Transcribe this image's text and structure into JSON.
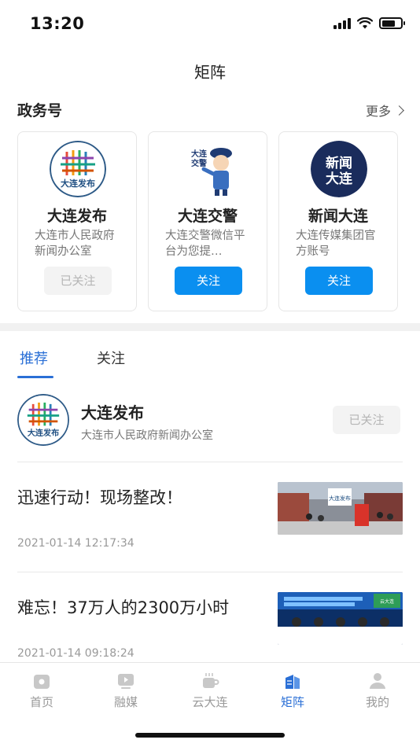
{
  "status_bar": {
    "time": "13:20"
  },
  "nav": {
    "title": "矩阵"
  },
  "gov_section": {
    "title": "政务号",
    "more_label": "更多"
  },
  "cards": [
    {
      "name": "大连发布",
      "desc": "大连市人民政府新闻办公室",
      "button": "已关注",
      "followed": true,
      "logo_text": "大连发布"
    },
    {
      "name": "大连交警",
      "desc": "大连交警微信平台为您提…",
      "button": "关注",
      "followed": false,
      "logo_text": "大连交警"
    },
    {
      "name": "新闻大连",
      "desc": "大连传媒集团官方账号",
      "button": "关注",
      "followed": false,
      "logo_text": "新闻大连"
    }
  ],
  "tabs": [
    {
      "label": "推荐",
      "active": true
    },
    {
      "label": "关注",
      "active": false
    }
  ],
  "account": {
    "name": "大连发布",
    "desc": "大连市人民政府新闻办公室",
    "button": "已关注",
    "logo_text": "大连发布"
  },
  "news": [
    {
      "title": "迅速行动！现场整改！",
      "date": "2021-01-14 12:17:34",
      "thumb_sign": "大连发布"
    },
    {
      "title": "难忘！37万人的2300万小时",
      "date": "2021-01-14 09:18:24",
      "thumb_sign": "云大连"
    }
  ],
  "tabbar": [
    {
      "label": "首页",
      "icon": "home-icon",
      "active": false
    },
    {
      "label": "融媒",
      "icon": "video-icon",
      "active": false
    },
    {
      "label": "云大连",
      "icon": "cup-icon",
      "active": false
    },
    {
      "label": "矩阵",
      "icon": "matrix-icon",
      "active": true
    },
    {
      "label": "我的",
      "icon": "user-icon",
      "active": false
    }
  ],
  "colors": {
    "accent": "#2a6fd6",
    "follow_button": "#0a8ff0",
    "followed_button_bg": "#f3f3f3"
  }
}
